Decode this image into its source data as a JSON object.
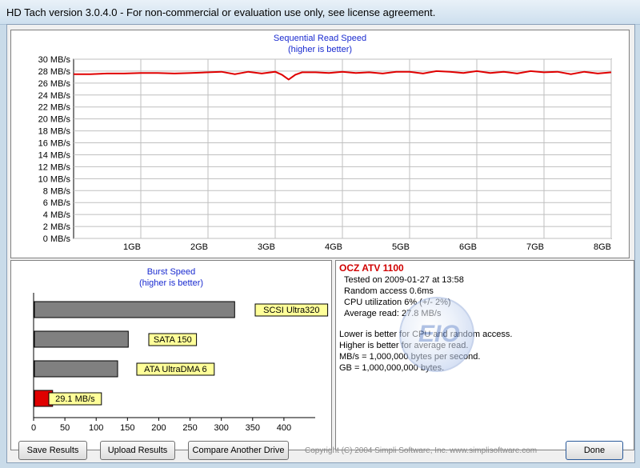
{
  "window": {
    "title": "HD Tach version 3.0.4.0  - For non-commercial or evaluation use only, see license agreement."
  },
  "seq_chart": {
    "title": "Sequential Read Speed",
    "subtitle": "(higher is better)",
    "y_ticks": [
      "30 MB/s",
      "28 MB/s",
      "26 MB/s",
      "24 MB/s",
      "22 MB/s",
      "20 MB/s",
      "18 MB/s",
      "16 MB/s",
      "14 MB/s",
      "12 MB/s",
      "10 MB/s",
      "8 MB/s",
      "6 MB/s",
      "4 MB/s",
      "2 MB/s",
      "0 MB/s"
    ],
    "x_ticks": [
      "1GB",
      "2GB",
      "3GB",
      "4GB",
      "5GB",
      "6GB",
      "7GB",
      "8GB"
    ]
  },
  "burst_chart": {
    "title": "Burst Speed",
    "subtitle": "(higher is better)",
    "x_ticks": [
      "0",
      "50",
      "100",
      "150",
      "200",
      "250",
      "300",
      "350",
      "400"
    ]
  },
  "chart_data": [
    {
      "type": "line",
      "title": "Sequential Read Speed",
      "subtitle": "(higher is better)",
      "xlabel": "",
      "ylabel": "",
      "xlim": [
        0,
        8
      ],
      "ylim": [
        0,
        30
      ],
      "grid": true,
      "series": [
        {
          "color": "#e00000",
          "x": [
            0,
            0.25,
            0.5,
            0.75,
            1.0,
            1.25,
            1.5,
            1.75,
            2.0,
            2.2,
            2.4,
            2.6,
            2.8,
            3.0,
            3.1,
            3.2,
            3.3,
            3.4,
            3.6,
            3.8,
            4.0,
            4.2,
            4.4,
            4.6,
            4.8,
            5.0,
            5.2,
            5.4,
            5.6,
            5.8,
            6.0,
            6.2,
            6.4,
            6.6,
            6.8,
            7.0,
            7.2,
            7.4,
            7.6,
            7.8,
            8.0
          ],
          "y": [
            27.5,
            27.5,
            27.6,
            27.6,
            27.7,
            27.7,
            27.6,
            27.7,
            27.8,
            27.9,
            27.5,
            27.9,
            27.6,
            27.9,
            27.4,
            26.6,
            27.4,
            27.8,
            27.8,
            27.7,
            27.9,
            27.7,
            27.8,
            27.6,
            27.9,
            27.9,
            27.6,
            28.0,
            27.9,
            27.7,
            28.0,
            27.7,
            27.9,
            27.6,
            28.0,
            27.8,
            27.9,
            27.5,
            27.9,
            27.6,
            27.8
          ]
        }
      ]
    },
    {
      "type": "bar",
      "title": "Burst Speed",
      "subtitle": "(higher is better)",
      "orientation": "horizontal",
      "xlim": [
        0,
        450
      ],
      "categories": [
        "SCSI Ultra320",
        "SATA 150",
        "ATA UltraDMA 6",
        "29.1 MB/s"
      ],
      "values": [
        320,
        150,
        133,
        29.1
      ],
      "colors": [
        "#808080",
        "#808080",
        "#808080",
        "#e00000"
      ]
    }
  ],
  "info": {
    "drive_name": "OCZ ATV 1100",
    "tested_on": "Tested on 2009-01-27 at 13:58",
    "random_access": "Random access 0.6ms",
    "cpu": "CPU utilization 6% (+/- 2%)",
    "avg_read": "Average read: 27.8 MB/s",
    "note1": "Lower is better for CPU and random access.",
    "note2": "Higher is better for average read.",
    "note3": "MB/s = 1,000,000 bytes per second.",
    "note4": "GB = 1,000,000,000 bytes."
  },
  "watermark_text": "EIO",
  "buttons": {
    "save": "Save Results",
    "upload": "Upload Results",
    "compare": "Compare Another Drive",
    "done": "Done"
  },
  "copyright": "Copyright (C) 2004 Simpli Software, Inc. www.simplisoftware.com"
}
